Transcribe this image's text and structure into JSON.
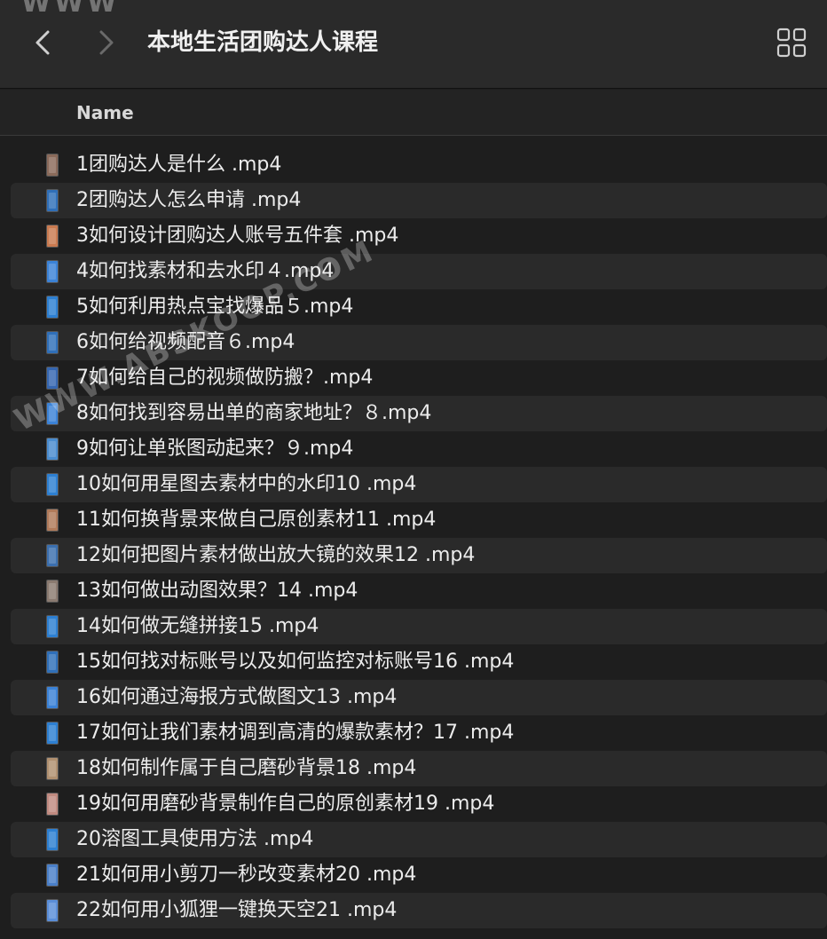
{
  "window": {
    "title": "本地生活团购达人课程",
    "back_icon": "chevron-left-icon",
    "forward_icon": "chevron-right-icon",
    "view_icon": "grid-view-icon"
  },
  "header": {
    "name_column": "Name"
  },
  "files": [
    {
      "name": "1团购达人是什么 .mp4",
      "thumb_color": "#8a6a5a"
    },
    {
      "name": "2团购达人怎么申请 .mp4",
      "thumb_color": "#2f6fb8"
    },
    {
      "name": "3如何设计团购达人账号五件套 .mp4",
      "thumb_color": "#c97a50"
    },
    {
      "name": "4如何找素材和去水印４.mp4",
      "thumb_color": "#3b82d6"
    },
    {
      "name": "5如何利用热点宝找爆品５.mp4",
      "thumb_color": "#2d7fd1"
    },
    {
      "name": "6如何给视频配音６.mp4",
      "thumb_color": "#2f6fb8"
    },
    {
      "name": "7如何给自己的视频做防搬？.mp4",
      "thumb_color": "#3566b0"
    },
    {
      "name": "8如何找到容易出单的商家地址？８.mp4",
      "thumb_color": "#3b82d6"
    },
    {
      "name": "9如何让单张图动起来？９.mp4",
      "thumb_color": "#4a8ccf"
    },
    {
      "name": "10如何用星图去素材中的水印10 .mp4",
      "thumb_color": "#2d7fd1"
    },
    {
      "name": "11如何换背景来做自己原创素材11 .mp4",
      "thumb_color": "#b07a5a"
    },
    {
      "name": "12如何把图片素材做出放大镜的效果12 .mp4",
      "thumb_color": "#3b6fae"
    },
    {
      "name": "13如何做出动图效果？14 .mp4",
      "thumb_color": "#8a7a70"
    },
    {
      "name": "14如何做无缝拼接15 .mp4",
      "thumb_color": "#2d7fd1"
    },
    {
      "name": "15如何找对标账号以及如何监控对标账号16 .mp4",
      "thumb_color": "#2f6fb8"
    },
    {
      "name": "16如何通过海报方式做图文13 .mp4",
      "thumb_color": "#3b82d6"
    },
    {
      "name": "17如何让我们素材调到高清的爆款素材？17 .mp4",
      "thumb_color": "#2d7fd1"
    },
    {
      "name": "18如何制作属于自己磨砂背景18 .mp4",
      "thumb_color": "#b09070"
    },
    {
      "name": "19如何用磨砂背景制作自己的原创素材19 .mp4",
      "thumb_color": "#c08a80"
    },
    {
      "name": "20溶图工具使用方法 .mp4",
      "thumb_color": "#2d7fd1"
    },
    {
      "name": "21如何用小剪刀一秒改变素材20 .mp4",
      "thumb_color": "#4a7fc8"
    },
    {
      "name": "22如何用小狐狸一键换天空21 .mp4",
      "thumb_color": "#5a8ed8"
    }
  ],
  "watermarks": {
    "top": "WWW",
    "middle": "WWW.ABSKOOP.COM"
  }
}
